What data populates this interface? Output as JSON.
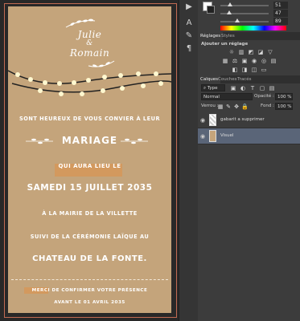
{
  "card": {
    "names_line1": "Julie",
    "names_amp": "&",
    "names_line2": "Romain",
    "invite": "SONT HEUREUX DE VOUS CONVIER À LEUR",
    "mariage": "MARIAGE",
    "aura_lieu": "QUI AURA LIEU LE",
    "date": "SAMEDI 15 JUILLET 2035",
    "mairie": "À LA MAIRIE DE LA VILLETTE",
    "suivi": "SUIVI DE LA CÉRÉMONIE LAÏQUE AU",
    "chateau": "CHATEAU DE LA FONTE.",
    "rsvp": "MERCI DE CONFIRMER VOTRE PRÉSENCE",
    "rsvp_date": "AVANT LE 01 AVRIL 2035",
    "background_color": "#c4a47b"
  },
  "color_panel": {
    "sliders": [
      {
        "label": "R",
        "value": "51",
        "level": 0.2
      },
      {
        "label": "G",
        "value": "47",
        "level": 0.18
      },
      {
        "label": "B",
        "value": "89",
        "level": 0.35
      }
    ]
  },
  "adjustments": {
    "tabs": [
      "Réglages",
      "Styles"
    ],
    "subtitle": "Ajouter un réglage"
  },
  "layers": {
    "tabs": [
      "Calques",
      "Couches",
      "Tracés"
    ],
    "filter_kind": "Type",
    "blend_mode": "Normal",
    "opacity_label": "Opacité :",
    "opacity_value": "100 %",
    "lock_label": "Verrou :",
    "fill_label": "Fond :",
    "fill_value": "100 %",
    "items": [
      {
        "name": "gabarit a supprimer",
        "selected": false
      },
      {
        "name": "Visuel",
        "selected": true
      }
    ]
  },
  "tools": [
    "play-icon",
    "type-icon",
    "brush-icon",
    "paragraph-icon"
  ]
}
